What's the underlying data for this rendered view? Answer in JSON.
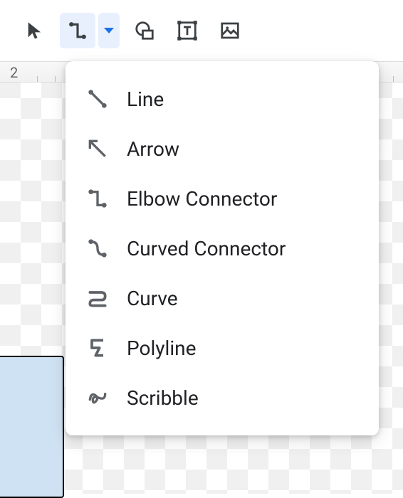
{
  "ruler": {
    "label": "2"
  },
  "menu": {
    "items": [
      {
        "label": "Line"
      },
      {
        "label": "Arrow"
      },
      {
        "label": "Elbow Connector"
      },
      {
        "label": "Curved Connector"
      },
      {
        "label": "Curve"
      },
      {
        "label": "Polyline"
      },
      {
        "label": "Scribble"
      }
    ]
  }
}
